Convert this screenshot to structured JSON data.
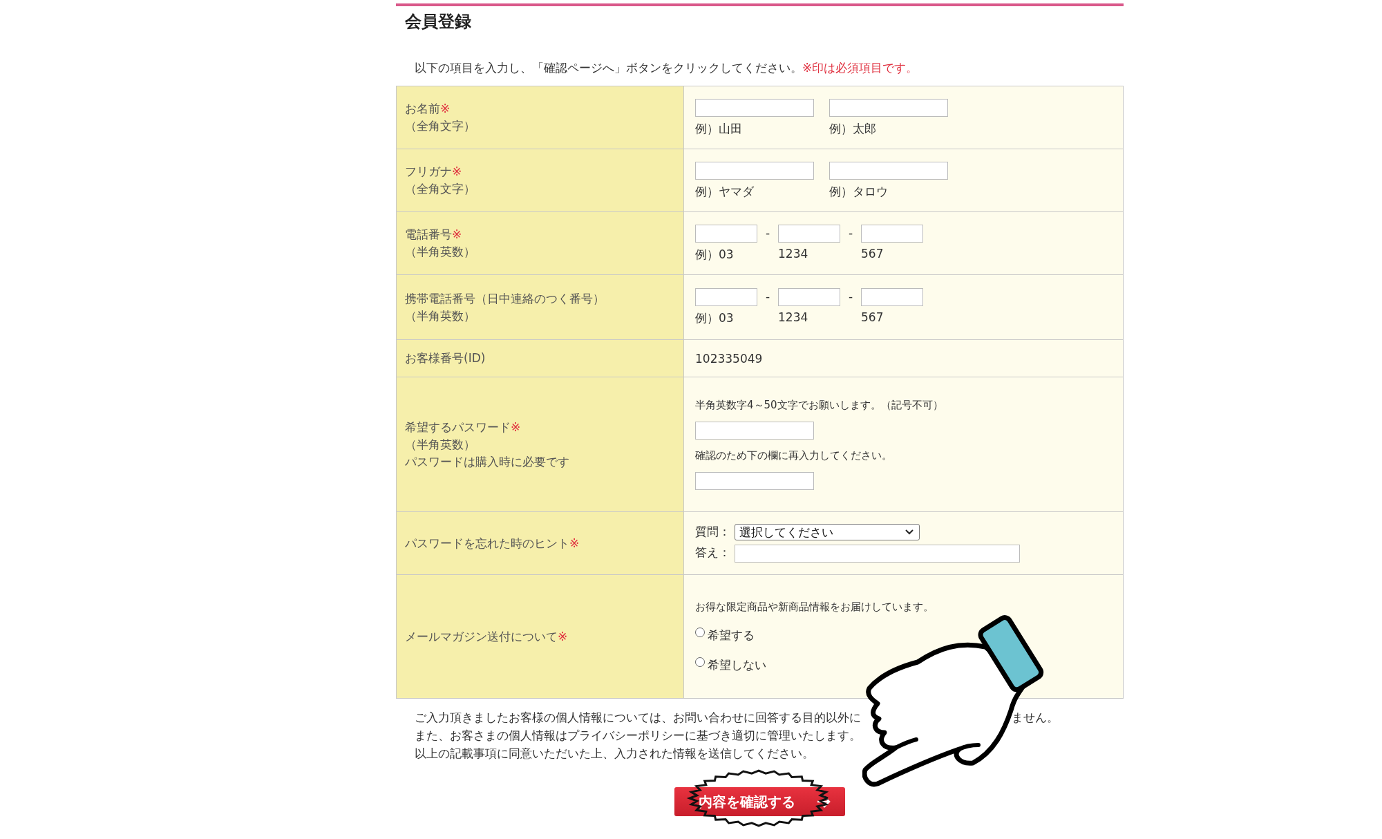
{
  "title": "会員登録",
  "instruction": {
    "text": "以下の項目を入力し、「確認ページへ」ボタンをクリックしてください。",
    "required_note": "※印は必須項目です。"
  },
  "rows": [
    {
      "kind": "name",
      "label": "お名前",
      "required_mark": "※",
      "sublabels": [
        "（全角文字）"
      ],
      "fields": [
        {
          "example": "例）山田"
        },
        {
          "example": "例）太郎"
        }
      ]
    },
    {
      "kind": "name",
      "label": "フリガナ",
      "required_mark": "※",
      "sublabels": [
        "（全角文字）"
      ],
      "fields": [
        {
          "example": "例）ヤマダ"
        },
        {
          "example": "例）タロウ"
        }
      ]
    },
    {
      "kind": "phone",
      "label": "電話番号",
      "required_mark": "※",
      "sublabels": [
        "（半角英数）"
      ],
      "separator": "-",
      "fields": [
        {
          "example": "例）03"
        },
        {
          "example": "1234"
        },
        {
          "example": "567"
        }
      ]
    },
    {
      "kind": "phone",
      "label": "携帯電話番号（日中連絡のつく番号）",
      "sublabels": [
        "（半角英数）"
      ],
      "separator": "-",
      "fields": [
        {
          "example": "例）03"
        },
        {
          "example": "1234"
        },
        {
          "example": "567"
        }
      ]
    },
    {
      "kind": "text",
      "label": "お客様番号(ID)",
      "value": "102335049"
    },
    {
      "kind": "password",
      "label": "希望するパスワード",
      "required_mark": "※",
      "sublabels": [
        "（半角英数）",
        "パスワードは購入時に必要です"
      ],
      "notes": [
        "半角英数字4～50文字でお願いします。（記号不可）",
        "確認のため下の欄に再入力してください。"
      ]
    },
    {
      "kind": "hint",
      "label": "パスワードを忘れた時のヒント",
      "required_mark": "※",
      "question_label": "質問：",
      "question_value": "選択してください",
      "answer_label": "答え："
    },
    {
      "kind": "radio",
      "label": "メールマガジン送付について",
      "required_mark": "※",
      "note": "お得な限定商品や新商品情報をお届けしています。",
      "options": [
        {
          "label": "希望する",
          "selected": false
        },
        {
          "label": "希望しない",
          "selected": false
        }
      ]
    }
  ],
  "privacy_lines": [
    [
      "ご入力頂きましたお客様の個人情報については、お問い合わせに回答する目的以外に",
      "ません。"
    ],
    [
      "また、お客さまの個人情報はプライバシーポリシーに基づき適切に管理いたします。"
    ],
    [
      "以上の記載事項に同意いただいた上、入力された情報を送信してください。"
    ]
  ],
  "submit_button": "内容を確認する"
}
